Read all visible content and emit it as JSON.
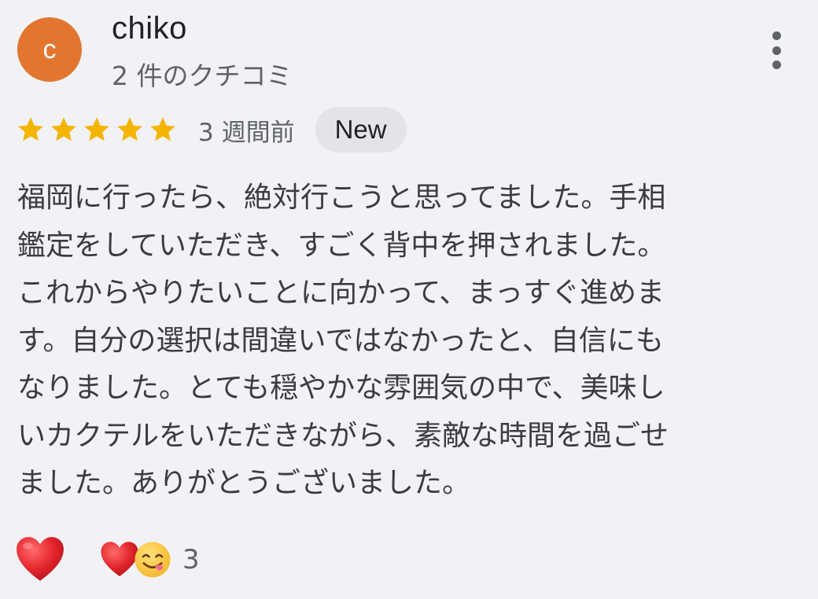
{
  "reviewer": {
    "initial": "c",
    "name": "chiko",
    "review_count_label": "2 件のクチコミ"
  },
  "rating": {
    "stars": 5,
    "time_ago": "3 週間前",
    "badge": "New",
    "star_color": "#f4b400"
  },
  "review": {
    "lines": [
      "福岡に行ったら、絶対行こうと思ってました。手相",
      "鑑定をしていただき、すごく背中を押されました。",
      "これからやりたいことに向かって、まっすぐ進めま",
      "す。自分の選択は間違いではなかったと、自信にも",
      "なりました。とても穏やかな雰囲気の中で、美味し",
      "いカクテルをいただきながら、素敵な時間を過ごせ",
      "ました。ありがとうございました。"
    ]
  },
  "reactions": {
    "react_icon": "heart-icon",
    "summary_icons": [
      "heart-icon",
      "yum-face-icon"
    ],
    "count": "3"
  },
  "colors": {
    "avatar_bg": "#e3762f",
    "background": "#f2f2f6",
    "badge_bg": "#e4e4e8",
    "heart": "#e3242b"
  }
}
